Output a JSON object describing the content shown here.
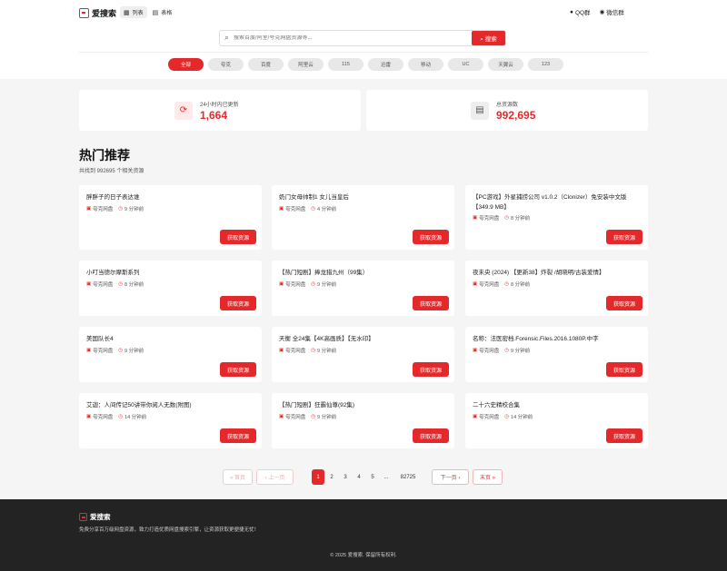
{
  "header": {
    "logo_text": "爱搜索",
    "view_list": "列表",
    "view_table": "表格",
    "qq_group": "QQ群",
    "wechat_group": "微信群"
  },
  "search": {
    "placeholder": "搜索百度/阿里/夸克网盘资源等...",
    "button": "搜索"
  },
  "categories": [
    "全部",
    "夸克",
    "百度",
    "阿里云",
    "115",
    "迅雷",
    "移动",
    "UC",
    "天翼云",
    "123"
  ],
  "stats": {
    "updated_label": "24小时内已更新",
    "updated_value": "1,664",
    "total_label": "总资源数",
    "total_value": "992,695"
  },
  "section": {
    "title": "热门推荐",
    "subtitle": "共找到 992695 个相关资源"
  },
  "cards": [
    {
      "title": "胖胖子的日子表达谁",
      "disk": "夸克网盘",
      "time": "9 分钟前",
      "btn": "获取资源"
    },
    {
      "title": "奶门女母帅制1 女儿当皇后",
      "disk": "夸克网盘",
      "time": "4 分钟前",
      "btn": "获取资源"
    },
    {
      "title": "【PC游戏】外星捕捞公司 v1.0.2（Clonizer）免安装中文版【349.9 MB】",
      "disk": "夸克网盘",
      "time": "8 分钟前",
      "btn": "获取资源"
    },
    {
      "title": "小叮当德尔摩斯系列",
      "disk": "夸克网盘",
      "time": "8 分钟前",
      "btn": "获取资源"
    },
    {
      "title": "【热门短剧】捧龙猎九州（99集）",
      "disk": "夸克网盘",
      "time": "9 分钟前",
      "btn": "获取资源"
    },
    {
      "title": "夜未央 (2024) 【更新38】炸裂 /胡晓明/古装爱情】",
      "disk": "夸克网盘",
      "time": "8 分钟前",
      "btn": "获取资源"
    },
    {
      "title": "美国队长4",
      "disk": "夸克网盘",
      "time": "9 分钟前",
      "btn": "获取资源"
    },
    {
      "title": "天衡 全24集【4K高画质】【无水印】",
      "disk": "夸克网盘",
      "time": "9 分钟前",
      "btn": "获取资源"
    },
    {
      "title": "名称：法医密档.Forensic.Files.2016.1080P.中字",
      "disk": "夸克网盘",
      "time": "9 分钟前",
      "btn": "获取资源"
    },
    {
      "title": "艾迦：人间传记50讲带你阅人无数(附图)",
      "disk": "夸克网盘",
      "time": "14 分钟前",
      "btn": "获取资源"
    },
    {
      "title": "【热门短剧】狂霸仙尊(92集)",
      "disk": "夸克网盘",
      "time": "9 分钟前",
      "btn": "获取资源"
    },
    {
      "title": "二十六史精校合集",
      "disk": "夸克网盘",
      "time": "14 分钟前",
      "btn": "获取资源"
    }
  ],
  "pagination": {
    "first": "« 首页",
    "prev": "‹ 上一页",
    "pages": [
      "1",
      "2",
      "3",
      "4",
      "5"
    ],
    "ellipsis": "...",
    "last_page": "82725",
    "next": "下一页 ›",
    "end": "末页 »"
  },
  "footer": {
    "logo_text": "爱搜索",
    "desc": "免费分享百万级网盘资源，致力打造优质网盘搜索引擎，让资源获取更便捷无忧！",
    "copyright": "© 2025 爱搜索. 保留所有权利."
  },
  "colors": {
    "accent": "#e5292b",
    "footer_bg": "#232323"
  }
}
